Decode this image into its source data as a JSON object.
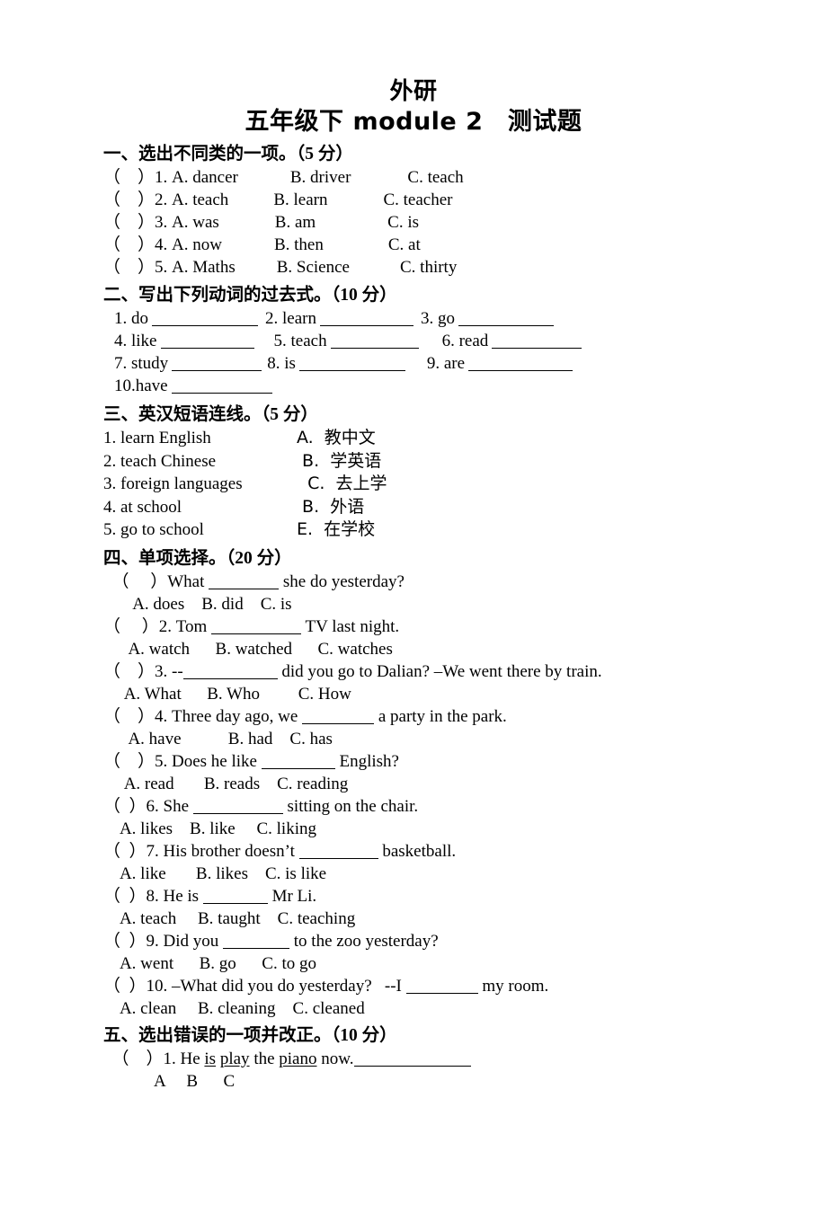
{
  "document": {
    "title_line1": "外研",
    "title_line2": "五年级下 module 2　测试题"
  },
  "sections": [
    {
      "heading": "一、选出不同类的一项。（5 分）",
      "questions": [
        {
          "prefix": "（    ）1. A. dancer",
          "optionB": "B. driver",
          "optionC": "C. teach"
        },
        {
          "prefix": "（    ）2. A. teach",
          "optionB": "B. learn",
          "optionC": "C. teacher"
        },
        {
          "prefix": "（    ）3. A. was",
          "optionB": "B. am",
          "optionC": "C. is"
        },
        {
          "prefix": "（    ）4. A. now",
          "optionB": "B. then",
          "optionC": "C. at"
        },
        {
          "prefix": "（    ）5. A. Maths",
          "optionB": "B. Science",
          "optionC": "C. thirty"
        }
      ]
    },
    {
      "heading": "二、写出下列动词的过去式。（10 分）",
      "rows": [
        {
          "item1": "1. do",
          "item2": "2. learn",
          "item3": "3. go"
        },
        {
          "item1": "4. like",
          "item2": "5. teach",
          "item3": "6. read"
        },
        {
          "item1": "7. study",
          "item2": "8. is",
          "item3": "9. are"
        },
        {
          "item1": "10.have",
          "item2": "",
          "item3": ""
        }
      ]
    },
    {
      "heading": "三、英汉短语连线。（5 分）",
      "pairs": [
        {
          "left": "1. learn English",
          "right": "A.  教中文"
        },
        {
          "left": "2. teach Chinese",
          "right": " B.  学英语"
        },
        {
          "left": "3. foreign languages",
          "right": "  C.  去上学"
        },
        {
          "left": "4. at school",
          "right": " B.  外语"
        },
        {
          "left": "5. go to school",
          "right": "E.  在学校"
        }
      ]
    },
    {
      "heading": "四、单项选择。（20 分）",
      "questions": [
        {
          "stem_pre": "  （     ）What ",
          "stem_post": " she do yesterday?",
          "blank_width": 78,
          "options": "       A. does    B. did    C. is"
        },
        {
          "stem_pre": "（     ）2. Tom ",
          "stem_post": " TV last night.",
          "blank_width": 100,
          "options": "      A. watch      B. watched      C. watches"
        },
        {
          "stem_pre": "（    ）3. --",
          "stem_post": " did you go to Dalian? –We went there by train.",
          "blank_width": 105,
          "options": "     A. What      B. Who         C. How"
        },
        {
          "stem_pre": "（    ）4. Three day ago, we ",
          "stem_post": " a party in the park.",
          "blank_width": 80,
          "options": "      A. have           B. had    C. has"
        },
        {
          "stem_pre": "（    ）5. Does he like ",
          "stem_post": " English?",
          "blank_width": 82,
          "options": "     A. read       B. reads    C. reading"
        },
        {
          "stem_pre": "（  ）6. She ",
          "stem_post": " sitting on the chair.",
          "blank_width": 100,
          "options": "    A. likes    B. like     C. liking"
        },
        {
          "stem_pre": "（  ）7. His brother doesn’t ",
          "stem_post": " basketball.",
          "blank_width": 88,
          "options": "    A. like       B. likes    C. is like"
        },
        {
          "stem_pre": "（  ）8. He is ",
          "stem_post": " Mr Li.",
          "blank_width": 72,
          "options": "    A. teach     B. taught    C. teaching"
        },
        {
          "stem_pre": "（  ）9. Did you ",
          "stem_post": " to the zoo yesterday?",
          "blank_width": 74,
          "options": "    A. went      B. go      C. to go"
        },
        {
          "stem_pre": "（  ）10. –What did you do yesterday?   --I ",
          "stem_post": " my room.",
          "blank_width": 80,
          "options": "    A. clean     B. cleaning    C. cleaned"
        }
      ]
    },
    {
      "heading": "五、选出错误的一项并改正。（10 分）",
      "correction": {
        "pre": "  （    ）1. He ",
        "word_a": "is",
        "mid1": " ",
        "word_b": "play",
        "mid2": " the ",
        "word_c": "piano",
        "post": " now.",
        "answer_blank_width": 130,
        "labels": "            A     B      C"
      }
    }
  ]
}
